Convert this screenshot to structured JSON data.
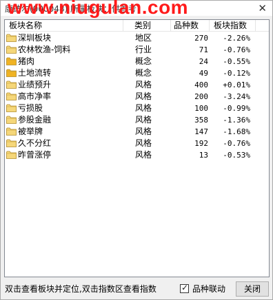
{
  "window": {
    "title": "康达尔(000048)  所属板块：供参考",
    "watermark": "www.niugulan.com"
  },
  "columns": {
    "name": "板块名称",
    "type": "类别",
    "count": "品种数",
    "index": "板块指数"
  },
  "rows": [
    {
      "name": "深圳板块",
      "type": "地区",
      "count": "270",
      "index": "-2.26%",
      "folder": "light"
    },
    {
      "name": "农林牧渔-饲料",
      "type": "行业",
      "count": "71",
      "index": "-0.76%",
      "folder": "light"
    },
    {
      "name": "猪肉",
      "type": "概念",
      "count": "24",
      "index": "-0.55%",
      "folder": "orange"
    },
    {
      "name": "土地流转",
      "type": "概念",
      "count": "49",
      "index": "-0.12%",
      "folder": "orange"
    },
    {
      "name": "业绩预升",
      "type": "风格",
      "count": "400",
      "index": "+0.01%",
      "folder": "light"
    },
    {
      "name": "高市净率",
      "type": "风格",
      "count": "200",
      "index": "-3.24%",
      "folder": "light"
    },
    {
      "name": "亏损股",
      "type": "风格",
      "count": "100",
      "index": "-0.99%",
      "folder": "light"
    },
    {
      "name": "参股金融",
      "type": "风格",
      "count": "358",
      "index": "-1.36%",
      "folder": "light"
    },
    {
      "name": "被举牌",
      "type": "风格",
      "count": "147",
      "index": "-1.68%",
      "folder": "light"
    },
    {
      "name": "久不分红",
      "type": "风格",
      "count": "192",
      "index": "-0.76%",
      "folder": "light"
    },
    {
      "name": "昨曾涨停",
      "type": "风格",
      "count": "13",
      "index": "-0.53%",
      "folder": "light"
    }
  ],
  "status": {
    "hint": "双击查看板块并定位,双击指数区查看指数",
    "checkbox_label": "品种联动",
    "checkbox_checked": true,
    "close_label": "关闭"
  },
  "colors": {
    "folder_light": "#f5d77a",
    "folder_orange": "#f0b323",
    "watermark": "#ff1a1a"
  }
}
